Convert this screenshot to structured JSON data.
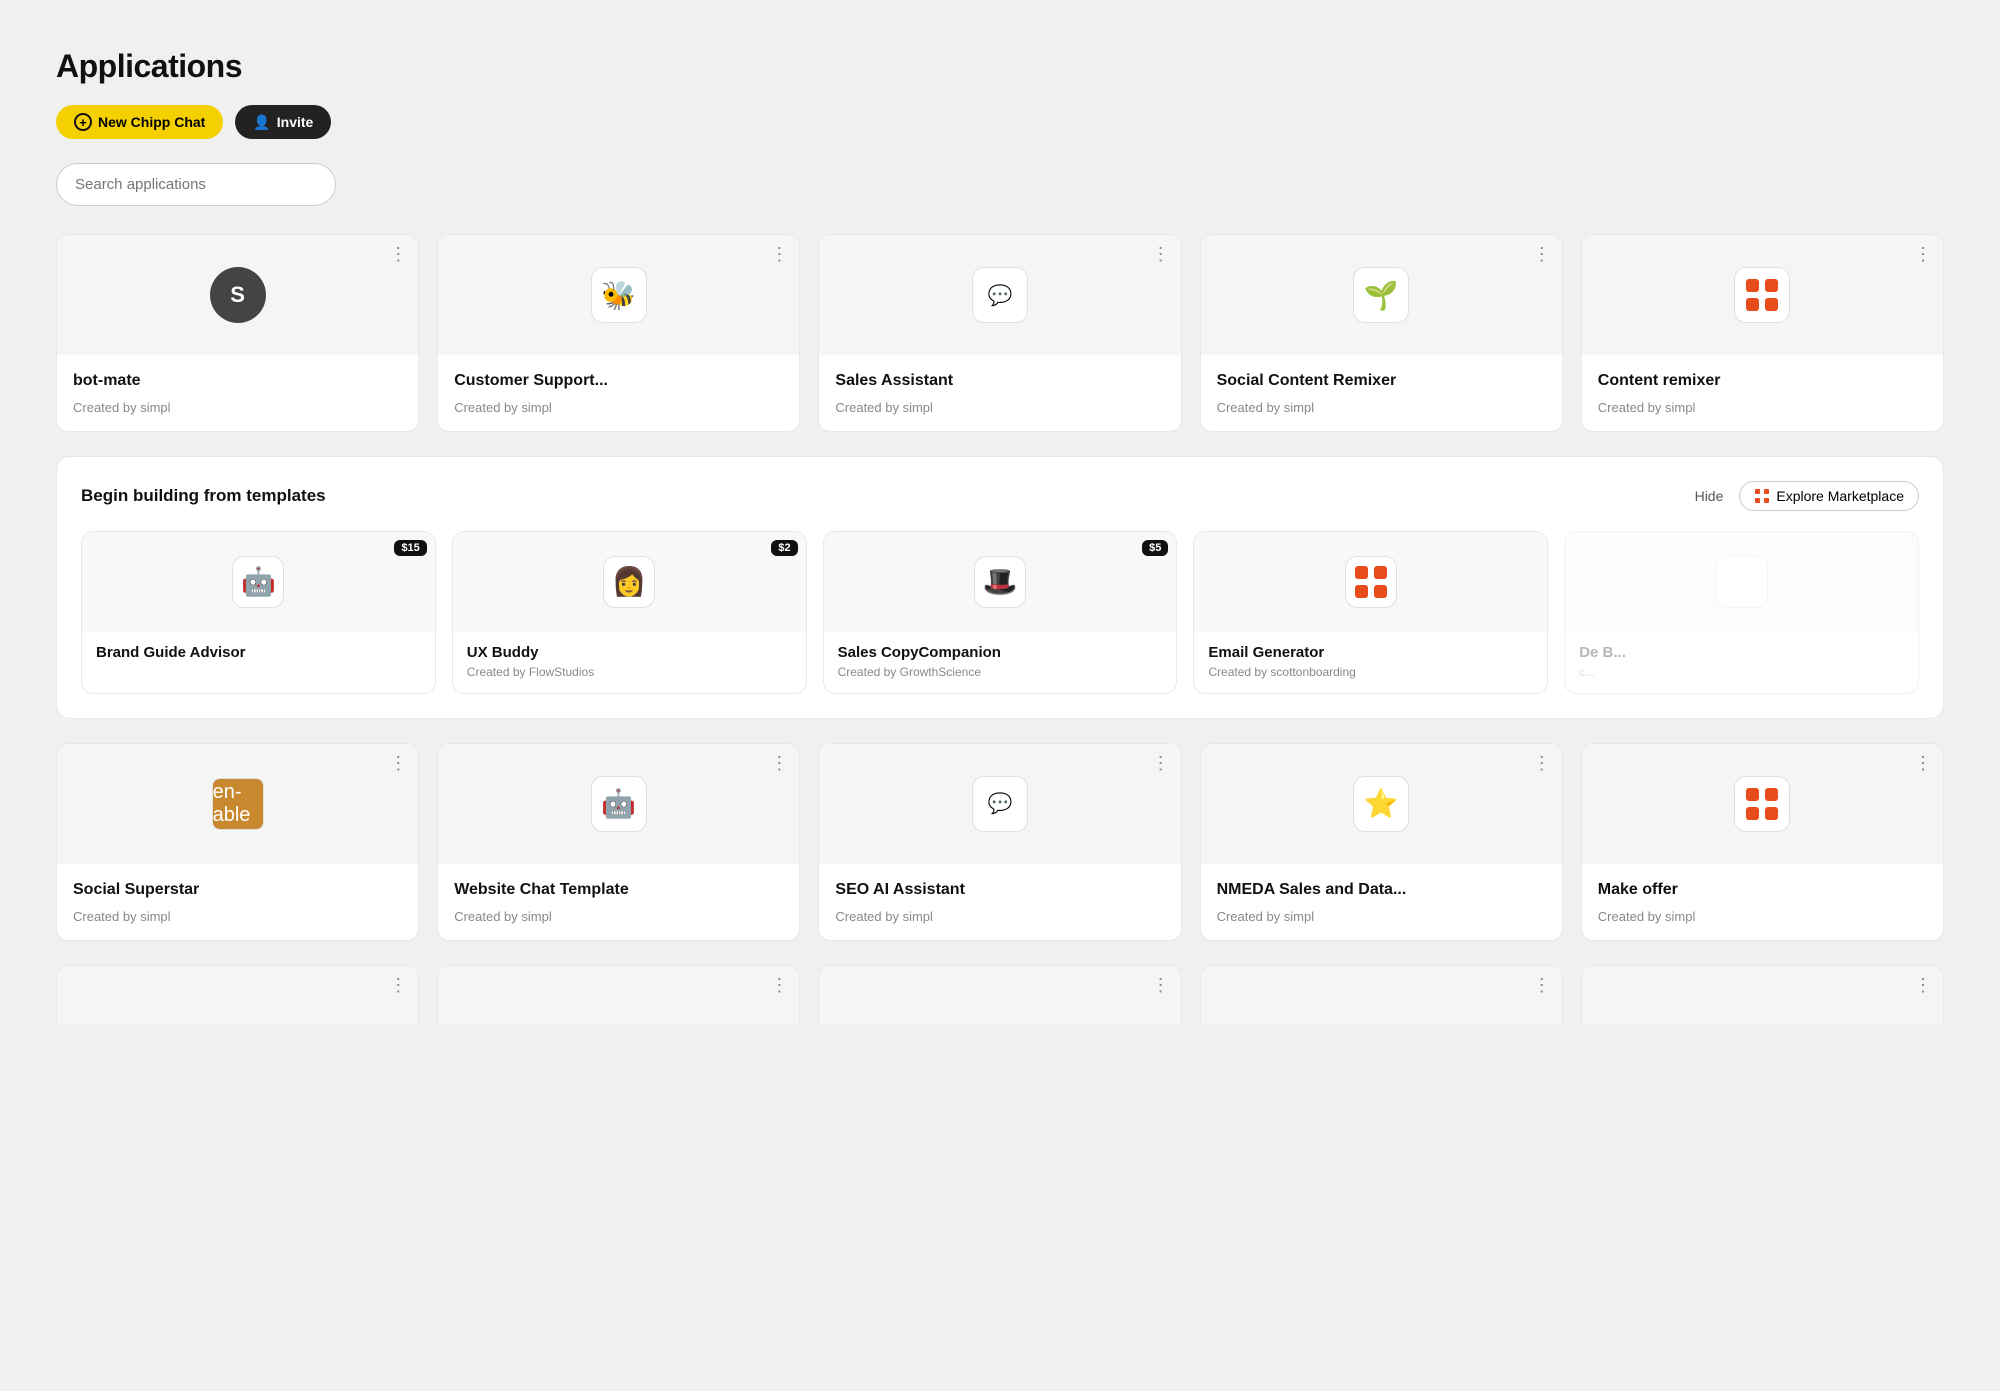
{
  "page": {
    "title": "Applications",
    "buttons": {
      "new_chat": "New Chipp Chat",
      "invite": "Invite"
    },
    "search": {
      "placeholder": "Search applications"
    }
  },
  "app_cards": [
    {
      "id": "bot-mate",
      "name": "bot-mate",
      "creator": "Created by simpl",
      "icon_type": "letter",
      "icon_letter": "S",
      "icon_emoji": ""
    },
    {
      "id": "customer-support",
      "name": "Customer Support...",
      "creator": "Created by simpl",
      "icon_type": "emoji",
      "icon_letter": "",
      "icon_emoji": "🐝"
    },
    {
      "id": "sales-assistant",
      "name": "Sales Assistant",
      "creator": "Created by simpl",
      "icon_type": "emoji",
      "icon_letter": "",
      "icon_emoji": "💬"
    },
    {
      "id": "social-content-remixer",
      "name": "Social Content Remixer",
      "creator": "Created by simpl",
      "icon_type": "emoji",
      "icon_letter": "",
      "icon_emoji": "🌱"
    },
    {
      "id": "content-remixer",
      "name": "Content remixer",
      "creator": "Created by simpl",
      "icon_type": "orange-grid",
      "icon_letter": "",
      "icon_emoji": ""
    }
  ],
  "templates_section": {
    "title": "Begin building from templates",
    "hide_label": "Hide",
    "explore_label": "Explore Marketplace",
    "cards": [
      {
        "id": "brand-guide-advisor",
        "name": "Brand Guide Advisor",
        "creator": "",
        "price": "$15",
        "icon_emoji": "🤖"
      },
      {
        "id": "ux-buddy",
        "name": "UX Buddy",
        "creator": "Created by FlowStudios",
        "price": "$2",
        "icon_emoji": "👩"
      },
      {
        "id": "sales-copy-companion",
        "name": "Sales CopyCompanion",
        "creator": "Created by GrowthScience",
        "price": "$5",
        "icon_emoji": "🎩"
      },
      {
        "id": "email-generator",
        "name": "Email Generator",
        "creator": "Created by scottonboarding",
        "price": "",
        "icon_emoji": "🔶"
      },
      {
        "id": "de-b",
        "name": "De B...",
        "creator": "c...",
        "price": "",
        "icon_emoji": ""
      }
    ]
  },
  "app_cards_row2": [
    {
      "id": "social-superstar",
      "name": "Social Superstar",
      "creator": "Created by simpl",
      "icon_type": "emoji",
      "icon_emoji": "🟤"
    },
    {
      "id": "website-chat-template",
      "name": "Website Chat Template",
      "creator": "Created by simpl",
      "icon_type": "emoji",
      "icon_emoji": "🤖"
    },
    {
      "id": "seo-ai-assistant",
      "name": "SEO AI Assistant",
      "creator": "Created by simpl",
      "icon_type": "emoji",
      "icon_emoji": "💬"
    },
    {
      "id": "nmeda-sales",
      "name": "NMEDA Sales and Data...",
      "creator": "Created by simpl",
      "icon_type": "emoji",
      "icon_emoji": "⭐"
    },
    {
      "id": "make-offer",
      "name": "Make offer",
      "creator": "Created by simpl",
      "icon_type": "orange-grid",
      "icon_emoji": ""
    }
  ]
}
